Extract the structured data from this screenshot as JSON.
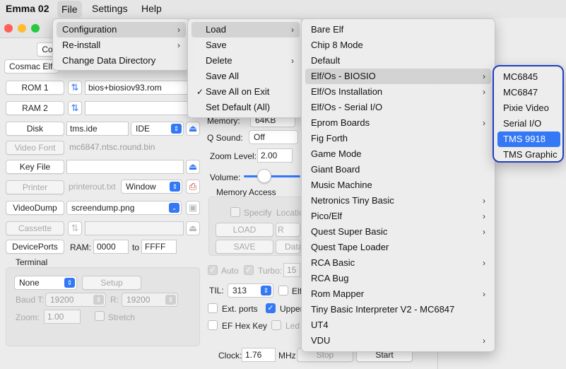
{
  "menubar": {
    "app": "Emma 02",
    "items": [
      "File",
      "Settings",
      "Help"
    ]
  },
  "window": {
    "tab_partial": "Co",
    "machine_select": "Cosmac Elf",
    "rom1": {
      "label": "ROM 1",
      "value": "bios+biosiov93.rom"
    },
    "ram2": {
      "label": "RAM 2",
      "value": ""
    },
    "disk": {
      "label": "Disk",
      "value": "tms.ide",
      "type": "IDE"
    },
    "video_font": {
      "label": "Video Font",
      "value": "mc6847.ntsc.round.bin"
    },
    "key_file": {
      "label": "Key File",
      "value": ""
    },
    "printer": {
      "label": "Printer",
      "value": "printerout.txt",
      "mode": "Window"
    },
    "video_dump": {
      "label": "VideoDump",
      "value": "screendump.png"
    },
    "cassette": {
      "label": "Cassette",
      "value": ""
    },
    "device_ports": {
      "label": "DevicePorts",
      "ram_label": "RAM:",
      "ram_from": "0000",
      "to_label": "to",
      "ram_to": "FFFF"
    },
    "terminal": {
      "title": "Terminal",
      "type": "None",
      "setup": "Setup",
      "baud_t_label": "Baud T:",
      "baud_t": "19200",
      "r_label": "R:",
      "baud_r": "19200",
      "zoom_label": "Zoom:",
      "zoom": "1.00",
      "stretch": "Stretch"
    },
    "memory_label": "Memory:",
    "memory_value": "64KB",
    "q_sound_label": "Q Sound:",
    "q_sound": "Off",
    "zoom_level_label": "Zoom Level:",
    "zoom_level": "2.00",
    "volume_label": "Volume:",
    "memory_access": {
      "title": "Memory Access",
      "specify": "Specify",
      "location_partial": "Locatio",
      "load": "LOAD",
      "r_partial": "R",
      "save": "SAVE",
      "data_partial": "Data"
    },
    "auto_label": "Auto",
    "turbo_label": "Turbo:",
    "turbo_value": "15",
    "til_label": "TIL:",
    "til_value": "313",
    "elf_partial": "Elf",
    "ext_ports": "Ext. ports",
    "upper_partial": "Upper",
    "ef_hex_key": "EF Hex Key",
    "led_partial": "Led",
    "clock_label": "Clock:",
    "clock_value": "1.76",
    "mhz": "MHz",
    "stop": "Stop",
    "start": "Start"
  },
  "file_menu": {
    "items": [
      {
        "label": "Configuration",
        "submenu": true
      },
      {
        "label": "Re-install",
        "submenu": true
      },
      {
        "label": "Change Data Directory",
        "submenu": false
      }
    ]
  },
  "config_menu": {
    "items": [
      {
        "label": "Load",
        "submenu": true
      },
      {
        "label": "Save",
        "submenu": false
      },
      {
        "label": "Delete",
        "submenu": true
      },
      {
        "label": "Save All",
        "submenu": false
      },
      {
        "label": "Save All on Exit",
        "checked": true
      },
      {
        "label": "Set Default (All)",
        "submenu": false
      }
    ]
  },
  "load_menu": {
    "items": [
      {
        "label": "Bare Elf",
        "submenu": false
      },
      {
        "label": "Chip 8 Mode",
        "submenu": false
      },
      {
        "label": "Default",
        "submenu": false
      },
      {
        "label": "Elf/Os - BIOSIO",
        "submenu": true
      },
      {
        "label": "Elf/Os Installation",
        "submenu": true
      },
      {
        "label": "Elf/Os - Serial I/O",
        "submenu": false
      },
      {
        "label": "Eprom Boards",
        "submenu": true
      },
      {
        "label": "Fig Forth",
        "submenu": false
      },
      {
        "label": "Game Mode",
        "submenu": false
      },
      {
        "label": "Giant Board",
        "submenu": false
      },
      {
        "label": "Music Machine",
        "submenu": false
      },
      {
        "label": "Netronics Tiny Basic",
        "submenu": true
      },
      {
        "label": "Pico/Elf",
        "submenu": true
      },
      {
        "label": "Quest Super Basic",
        "submenu": true
      },
      {
        "label": "Quest Tape Loader",
        "submenu": false
      },
      {
        "label": "RCA Basic",
        "submenu": true
      },
      {
        "label": "RCA Bug",
        "submenu": false
      },
      {
        "label": "Rom Mapper",
        "submenu": true
      },
      {
        "label": "Tiny Basic Interpreter V2 - MC6847",
        "submenu": false
      },
      {
        "label": "UT4",
        "submenu": false
      },
      {
        "label": "VDU",
        "submenu": true
      }
    ]
  },
  "biosio_menu": {
    "items": [
      "MC6845",
      "MC6847",
      "Pixie Video",
      "Serial I/O",
      "TMS 9918",
      "TMS Graphic"
    ]
  }
}
